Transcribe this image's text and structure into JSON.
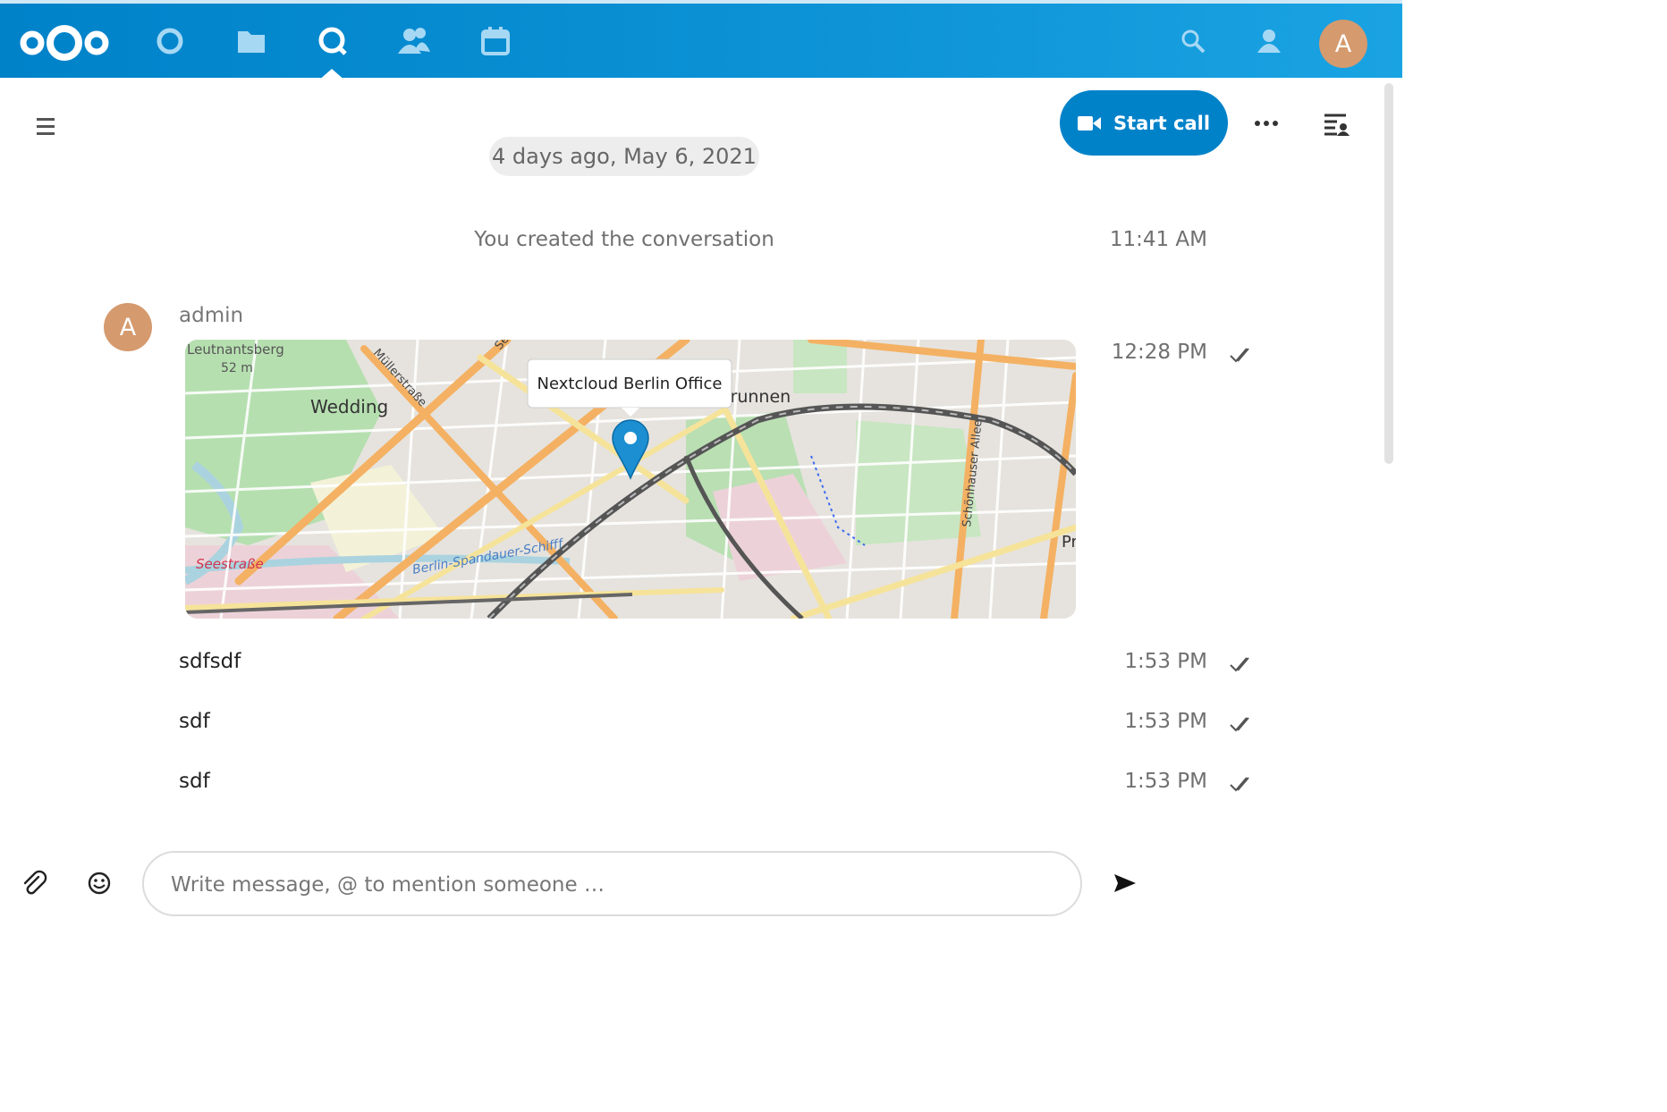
{
  "colors": {
    "brand": "#0082c9",
    "avatar": "#d59a6e"
  },
  "header": {
    "apps": [
      {
        "name": "dashboard",
        "icon": "circle-icon"
      },
      {
        "name": "files",
        "icon": "folder-icon"
      },
      {
        "name": "talk",
        "icon": "talk-icon",
        "active": true
      },
      {
        "name": "contacts",
        "icon": "contacts-icon"
      },
      {
        "name": "calendar",
        "icon": "calendar-icon"
      }
    ],
    "user_initial": "A"
  },
  "conversation": {
    "start_call_label": "Start call",
    "date_separator": "4 days ago, May 6, 2021",
    "system_message": {
      "text": "You created the conversation",
      "time": "11:41 AM"
    },
    "author": {
      "initial": "A",
      "name": "admin"
    },
    "messages": [
      {
        "type": "location",
        "time": "12:28 PM"
      },
      {
        "text": "sdfsdf",
        "time": "1:53 PM"
      },
      {
        "text": "sdf",
        "time": "1:53 PM"
      },
      {
        "text": "sdf",
        "time": "1:53 PM"
      }
    ],
    "map": {
      "popup": "Nextcloud Berlin Office",
      "labels": {
        "leutnantsberg": "Leutnantsberg",
        "elevation": "52 m",
        "wedding": "Wedding",
        "mullerstrasse": "Müllerstraße",
        "gesundbrunnen": "Gesundbrunnen",
        "seestrasse": "Seestraße",
        "schonhauser": "Schönhauser Allee",
        "canal": "Berlin-Spandauer-Schifff",
        "se": "Se",
        "pr": "Pr"
      }
    }
  },
  "composer": {
    "placeholder": "Write message, @ to mention someone …"
  }
}
